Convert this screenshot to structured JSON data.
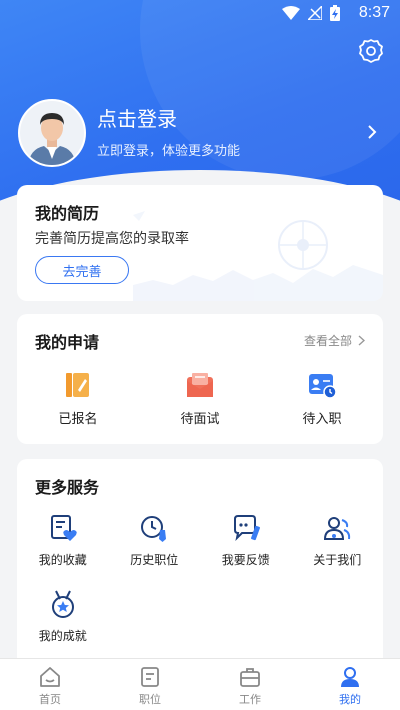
{
  "status": {
    "time": "8:37"
  },
  "profile": {
    "login_title": "点击登录",
    "login_subtitle": "立即登录，体验更多功能"
  },
  "resume": {
    "title": "我的简历",
    "description": "完善简历提高您的录取率",
    "button": "去完善"
  },
  "applications": {
    "title": "我的申请",
    "view_all": "查看全部",
    "items": [
      {
        "label": "已报名",
        "icon": "signed-up-icon"
      },
      {
        "label": "待面试",
        "icon": "interview-envelope-icon"
      },
      {
        "label": "待入职",
        "icon": "onboarding-id-card-icon"
      }
    ]
  },
  "services": {
    "title": "更多服务",
    "items": [
      {
        "label": "我的收藏",
        "icon": "favorites-icon"
      },
      {
        "label": "历史职位",
        "icon": "history-jobs-icon"
      },
      {
        "label": "我要反馈",
        "icon": "feedback-icon"
      },
      {
        "label": "关于我们",
        "icon": "about-us-icon"
      },
      {
        "label": "我的成就",
        "icon": "achievement-medal-icon"
      }
    ]
  },
  "tabs": [
    {
      "label": "首页",
      "icon": "home-icon",
      "active": false
    },
    {
      "label": "职位",
      "icon": "jobs-icon",
      "active": false
    },
    {
      "label": "工作",
      "icon": "work-briefcase-icon",
      "active": false
    },
    {
      "label": "我的",
      "icon": "profile-icon",
      "active": true
    }
  ],
  "colors": {
    "primary": "#2f6ff0",
    "accent_orange": "#f29a2e",
    "accent_red": "#f0705a",
    "accent_blue": "#3a7df3"
  }
}
